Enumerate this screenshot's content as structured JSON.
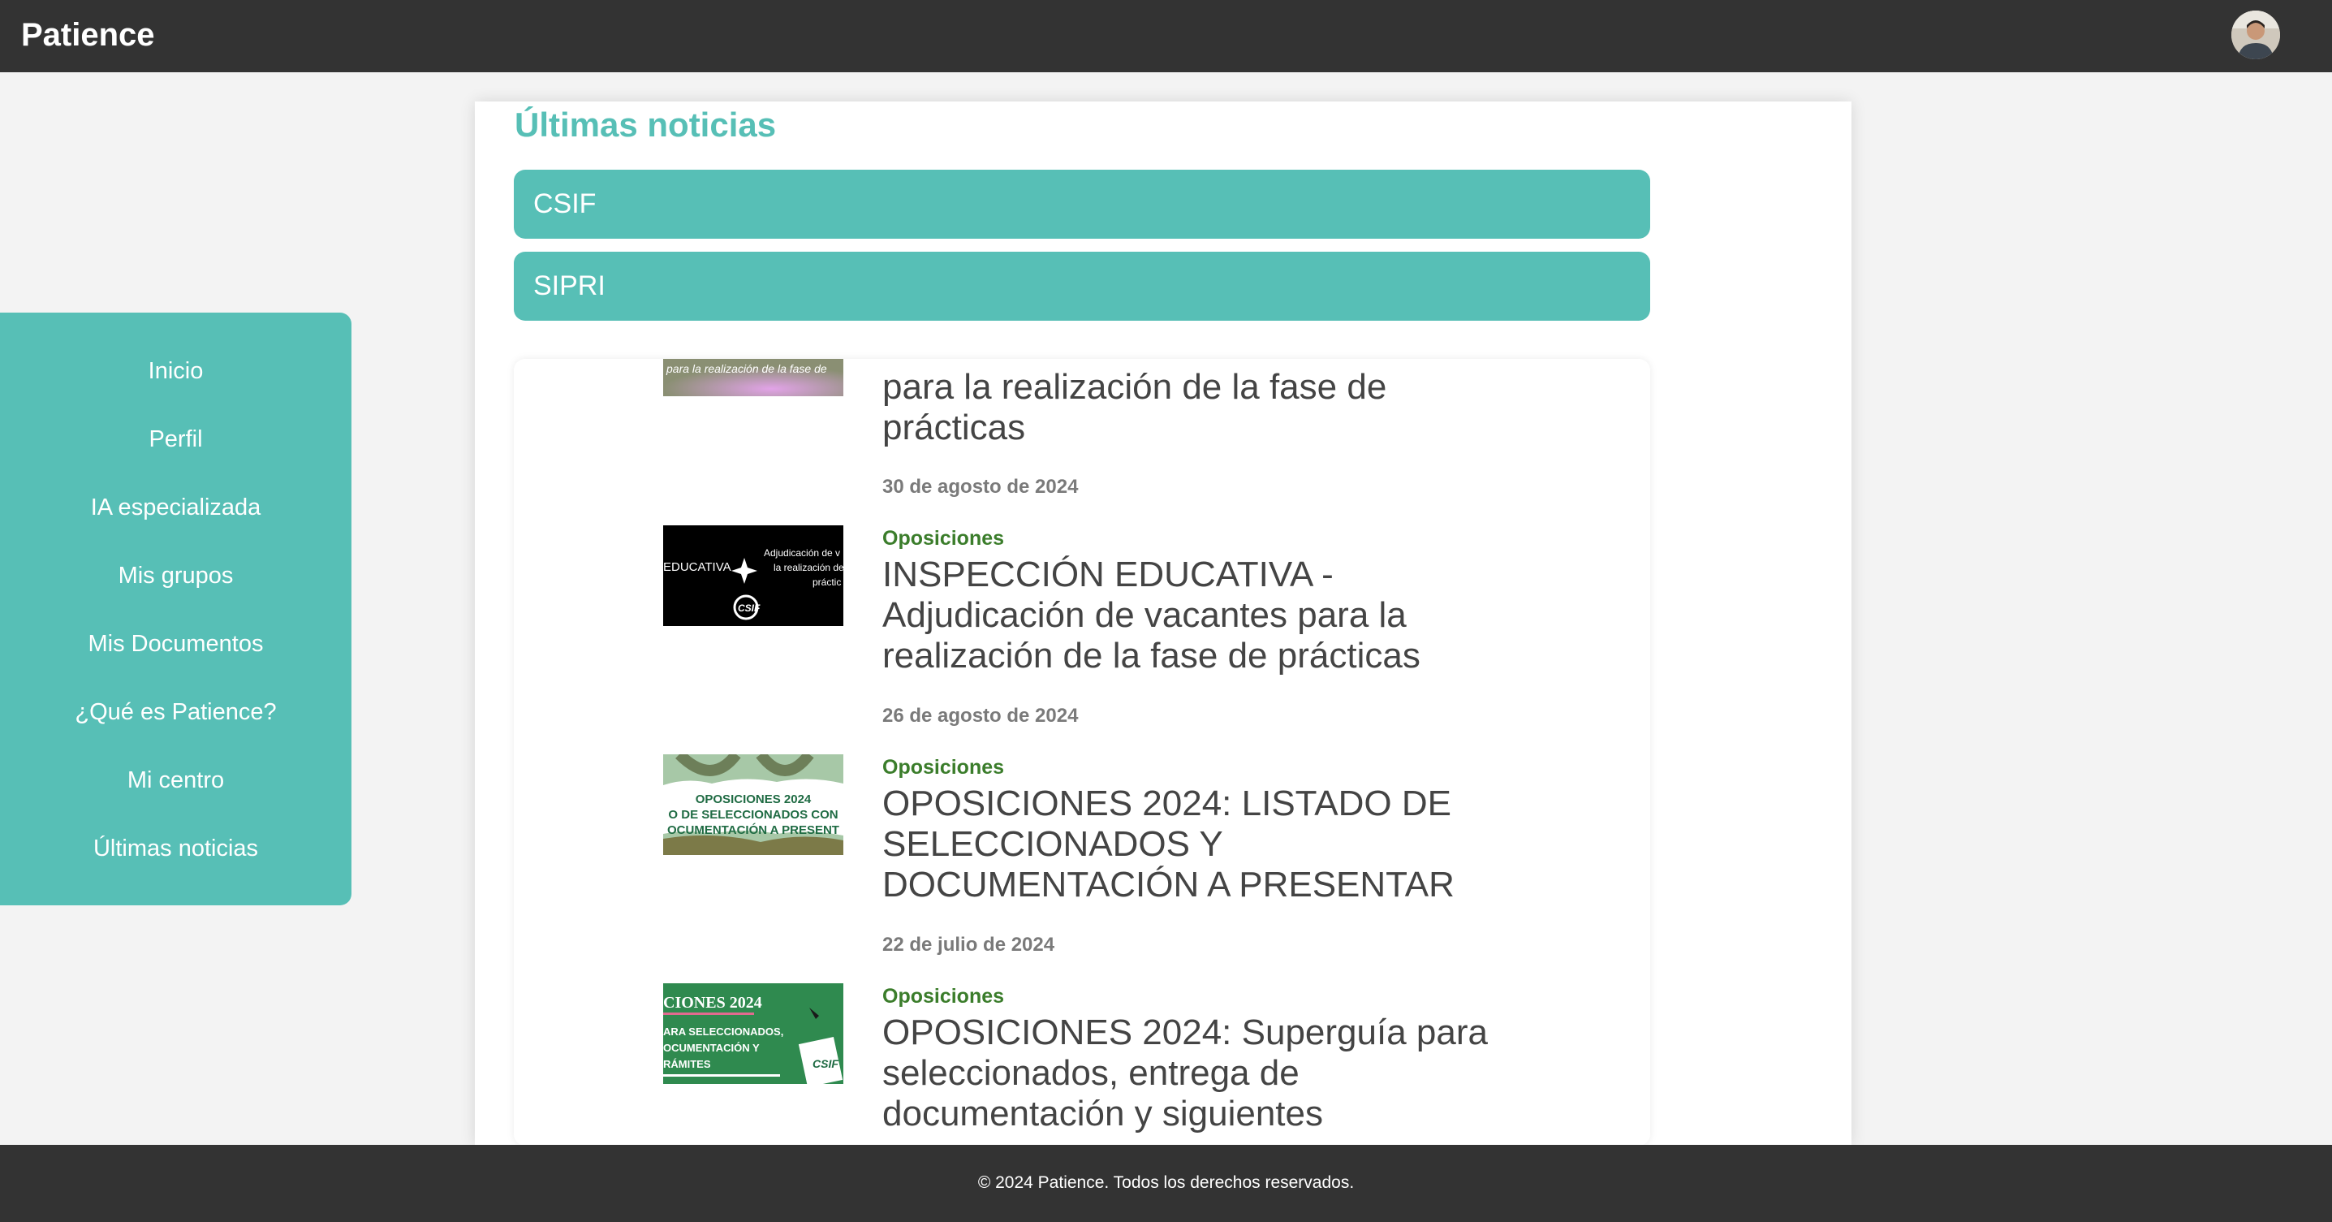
{
  "app": {
    "title": "Patience"
  },
  "colors": {
    "accent": "#57bfb6",
    "topbar": "#333333",
    "category": "#3b7d2b"
  },
  "sidebar": {
    "items": [
      {
        "label": "Inicio"
      },
      {
        "label": "Perfil"
      },
      {
        "label": "IA especializada"
      },
      {
        "label": "Mis grupos"
      },
      {
        "label": "Mis Documentos"
      },
      {
        "label": "¿Qué es Patience?"
      },
      {
        "label": "Mi centro"
      },
      {
        "label": "Últimas noticias"
      }
    ]
  },
  "main": {
    "title": "Últimas noticias",
    "sources": [
      {
        "label": "CSIF"
      },
      {
        "label": "SIPRI"
      }
    ],
    "news": [
      {
        "title": "para la realización de la fase de prácticas",
        "date": "30 de agosto de 2024",
        "thumb_text": "para la realización de la fase de"
      },
      {
        "category": "Oposiciones",
        "title": "INSPECCIÓN EDUCATIVA - Adjudicación de vacantes para la realización de la fase de prácticas",
        "date": "26 de agosto de 2024",
        "thumb_text": [
          "EDUCATIVA",
          "Adjudicación de v",
          "la realización de",
          "práctic",
          "CSIF"
        ]
      },
      {
        "category": "Oposiciones",
        "title": "OPOSICIONES 2024: LISTADO DE SELECCIONADOS Y DOCUMENTACIÓN A PRESENTAR",
        "date": "22 de julio de 2024",
        "thumb_text": [
          "OPOSICIONES 2024",
          "O DE SELECCIONADOS CON",
          "OCUMENTACIÓN A PRESENT"
        ]
      },
      {
        "category": "Oposiciones",
        "title": "OPOSICIONES 2024: Superguía para seleccionados, entrega de documentación y siguientes",
        "thumb_text": [
          "CIONES 2024",
          "ARA SELECCIONADOS,",
          "OCUMENTACIÓN Y",
          "RÁMITES",
          "CSIF"
        ]
      }
    ]
  },
  "footer": {
    "text": "© 2024 Patience. Todos los derechos reservados."
  }
}
